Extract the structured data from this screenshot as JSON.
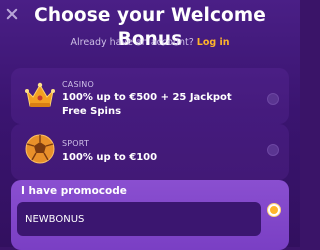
{
  "header": {
    "title": "Choose your Welcome Bonus",
    "account_prompt": "Already have an account?",
    "login_link": "Log in"
  },
  "bonuses": [
    {
      "category": "CASINO",
      "description": "100% up to €500 + 25 Jackpot Free Spins",
      "icon": "crown-icon",
      "selected": false
    },
    {
      "category": "SPORT",
      "description": "100% up to €100",
      "icon": "soccer-ball-icon",
      "selected": false
    }
  ],
  "promo": {
    "label": "I have promocode",
    "value": "NEWBONUS",
    "selected": true
  },
  "colors": {
    "accent": "#ffb42a",
    "background": "#3a1468",
    "promo_panel": "#7a3fc4"
  }
}
